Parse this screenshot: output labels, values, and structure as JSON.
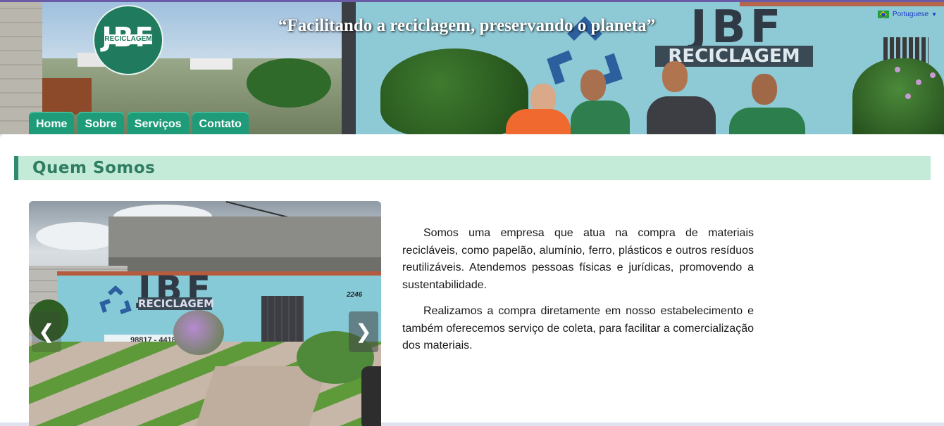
{
  "header": {
    "logo_text": "JBF",
    "logo_subtext": "RECICLAGEM",
    "slogan": "“Facilitando a reciclagem, preservando o planeta”",
    "language": {
      "flag": "brazil-flag-icon",
      "label": "Portuguese",
      "caret": "▼"
    },
    "building_sign": {
      "text": "JBF",
      "banner": "RECICLAGEM"
    }
  },
  "nav": {
    "items": [
      {
        "label": "Home"
      },
      {
        "label": "Sobre"
      },
      {
        "label": "Serviços"
      },
      {
        "label": "Contato"
      }
    ]
  },
  "section": {
    "title": "Quem Somos"
  },
  "carousel": {
    "prev_label": "❮",
    "next_label": "❯",
    "photo_sign": "JBF",
    "photo_banner": "RECICLAGEM",
    "photo_phone": "98817 - 4418",
    "photo_number": "2246"
  },
  "about": {
    "paragraphs": [
      "Somos uma empresa que atua na compra de materiais recicláveis, como papelão, alumínio, ferro, plásticos e outros resíduos reutilizáveis. Atendemos pessoas físicas e jurídicas, promovendo a sustentabilidade.",
      "Realizamos a compra diretamente em nosso estabelecimento e também oferecemos serviço de coleta, para facilitar a comercialização dos materiais."
    ]
  },
  "colors": {
    "brand_green": "#1e9b79",
    "title_bg": "#c4ead8",
    "title_text": "#2e7d63",
    "link_blue": "#1a36c7"
  }
}
